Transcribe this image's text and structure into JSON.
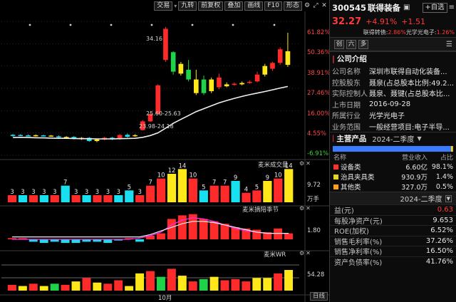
{
  "toolbar": {
    "buttons": [
      "交易",
      "九转",
      "前复权",
      "叠加",
      "画线",
      "F10",
      "形态"
    ],
    "icons": [
      "settings-icon",
      "expand-icon",
      "close-icon"
    ]
  },
  "chart": {
    "price_axis": [
      "61.82%",
      "50.36%",
      "38.91%",
      "27.46%",
      "16.00%",
      "4.55%",
      "-6.91%"
    ],
    "price_annotations": {
      "high": "34.16",
      "mid": "25.60-25.63",
      "low": "23.98-24.18"
    },
    "month_label": "10月",
    "panels": {
      "volume": {
        "title": "麦米成交量",
        "axis": [
          "9.72"
        ],
        "unit": "万手"
      },
      "macd": {
        "title": "麦米摘陪季节",
        "axis": [
          "1.80"
        ]
      },
      "wr": {
        "title": "麦米WR",
        "axis": [
          "54.28"
        ]
      }
    },
    "frequency": "日线"
  },
  "chart_data": {
    "type": "candlestick",
    "title": "",
    "y_axis_percent_ticks": [
      61.82,
      50.36,
      38.91,
      27.46,
      16.0,
      4.55,
      -6.91
    ],
    "labels": {
      "high": "34.16",
      "range_mid": "25.60-25.63",
      "range_low": "23.98-24.18"
    },
    "candles": [
      {
        "o": 3.0,
        "c": 3.6,
        "h": 4.0,
        "l": 2.6,
        "color": "cyan"
      },
      {
        "o": 3.5,
        "c": 3.3,
        "h": 3.9,
        "l": 3.0,
        "color": "cyan"
      },
      {
        "o": 3.3,
        "c": 3.0,
        "h": 3.8,
        "l": 2.8,
        "color": "cyan"
      },
      {
        "o": 3.0,
        "c": 3.4,
        "h": 3.8,
        "l": 2.7,
        "color": "yellow"
      },
      {
        "o": 3.3,
        "c": 3.0,
        "h": 3.6,
        "l": 2.8,
        "color": "cyan"
      },
      {
        "o": 3.0,
        "c": 3.2,
        "h": 3.5,
        "l": 2.6,
        "color": "yellow"
      },
      {
        "o": 2.8,
        "c": 2.3,
        "h": 3.3,
        "l": 2.0,
        "color": "cyan"
      },
      {
        "o": 2.3,
        "c": 2.5,
        "h": 2.9,
        "l": 1.8,
        "color": "yellow"
      },
      {
        "o": 2.5,
        "c": 1.5,
        "h": 2.9,
        "l": 1.2,
        "color": "cyan"
      },
      {
        "o": 1.5,
        "c": 2.0,
        "h": 2.4,
        "l": 1.0,
        "color": "yellow"
      },
      {
        "o": 2.0,
        "c": 0.4,
        "h": 2.4,
        "l": 0.0,
        "color": "cyan"
      },
      {
        "o": 0.4,
        "c": 1.2,
        "h": 1.6,
        "l": -0.2,
        "color": "yellow"
      },
      {
        "o": 1.2,
        "c": 2.1,
        "h": 2.6,
        "l": 0.8,
        "color": "red"
      },
      {
        "o": 2.1,
        "c": 1.4,
        "h": 2.5,
        "l": 0.9,
        "color": "cyan"
      },
      {
        "o": 1.4,
        "c": 3.5,
        "h": 4.1,
        "l": 1.0,
        "color": "red"
      },
      {
        "o": 3.6,
        "c": 2.6,
        "h": 4.3,
        "l": 2.2,
        "color": "cyan"
      },
      {
        "o": 3.0,
        "c": 3.4,
        "h": 3.9,
        "l": 2.6,
        "color": "yellow"
      },
      {
        "o": 6.0,
        "c": 10.5,
        "h": 11.2,
        "l": 5.8,
        "color": "red"
      },
      {
        "o": 10.5,
        "c": 14.3,
        "h": 15.0,
        "l": 10.2,
        "color": "red"
      },
      {
        "o": 14.3,
        "c": 29.0,
        "h": 29.5,
        "l": 14.0,
        "color": "red"
      },
      {
        "o": 42.0,
        "c": 58.0,
        "h": 59.0,
        "l": 41.0,
        "color": "red"
      },
      {
        "o": 46.0,
        "c": 36.0,
        "h": 46.5,
        "l": 34.5,
        "color": "green"
      },
      {
        "o": 35.0,
        "c": 40.0,
        "h": 41.0,
        "l": 34.0,
        "color": "yellow"
      },
      {
        "o": 37.0,
        "c": 32.0,
        "h": 42.0,
        "l": 31.0,
        "color": "green"
      },
      {
        "o": 32.0,
        "c": 25.0,
        "h": 37.0,
        "l": 24.0,
        "color": "yellow"
      },
      {
        "o": 25.0,
        "c": 32.0,
        "h": 34.0,
        "l": 24.0,
        "color": "green"
      },
      {
        "o": 32.0,
        "c": 26.0,
        "h": 33.0,
        "l": 25.0,
        "color": "yellow"
      },
      {
        "o": 28.0,
        "c": 33.0,
        "h": 35.0,
        "l": 27.0,
        "color": "red"
      },
      {
        "o": 28.5,
        "c": 29.5,
        "h": 30.5,
        "l": 28.0,
        "color": "yellow"
      },
      {
        "o": 29.2,
        "c": 29.8,
        "h": 30.5,
        "l": 28.8,
        "color": "red"
      },
      {
        "o": 29.5,
        "c": 30.2,
        "h": 31.0,
        "l": 29.0,
        "color": "yellow"
      },
      {
        "o": 30.2,
        "c": 30.8,
        "h": 31.5,
        "l": 29.8,
        "color": "red"
      },
      {
        "o": 31.0,
        "c": 34.5,
        "h": 36.0,
        "l": 30.5,
        "color": "red"
      },
      {
        "o": 34.5,
        "c": 38.9,
        "h": 40.0,
        "l": 33.5,
        "color": "yellow"
      },
      {
        "o": 37.5,
        "c": 40.5,
        "h": 41.0,
        "l": 36.5,
        "color": "red"
      },
      {
        "o": 40.5,
        "c": 47.5,
        "h": 48.5,
        "l": 39.5,
        "color": "red"
      },
      {
        "o": 39.5,
        "c": 46.5,
        "h": 56.0,
        "l": 38.5,
        "color": "yellow"
      }
    ],
    "ma_line": [
      2.2,
      2.3,
      2.2,
      2.1,
      2.0,
      1.9,
      1.8,
      1.8,
      1.7,
      1.6,
      1.6,
      1.5,
      1.5,
      1.5,
      1.6,
      1.7,
      1.8,
      2.3,
      3.2,
      4.6,
      7.0,
      9.5,
      11.5,
      13.5,
      15.5,
      17.0,
      18.5,
      20.0,
      21.2,
      22.3,
      23.3,
      24.2,
      25.0,
      25.8,
      26.7,
      27.6,
      28.4
    ],
    "volume": {
      "labels": [
        "3",
        "3",
        "3",
        "3",
        "3",
        "7",
        "3",
        "3",
        "3",
        "3",
        "3",
        "5",
        "3",
        "7",
        "10",
        "12",
        "14",
        "10",
        "5",
        "7",
        "7",
        "9",
        "4",
        "5",
        "9",
        "10",
        "14"
      ],
      "values": [
        3,
        3,
        3,
        3,
        3,
        7,
        3,
        3,
        3,
        3,
        3,
        5,
        3,
        7,
        10,
        12,
        14,
        10,
        5,
        7,
        7,
        9,
        4,
        5,
        9,
        10,
        14
      ],
      "colors": [
        "red",
        "cyan",
        "red",
        "cyan",
        "red",
        "cyan",
        "red",
        "cyan",
        "red",
        "red",
        "cyan",
        "cyan",
        "red",
        "red",
        "red",
        "yellow",
        "yellow",
        "red",
        "cyan",
        "red",
        "red",
        "cyan",
        "red",
        "red",
        "yellow",
        "red",
        "yellow"
      ]
    },
    "macd": {
      "values": [
        0.1,
        0.1,
        -0.2,
        -0.3,
        -0.2,
        -0.3,
        -0.3,
        -0.2,
        -0.2,
        -0.3,
        -0.1,
        0.1,
        -0.2,
        0.3,
        0.5,
        1.7,
        2.0,
        2.1,
        1.7,
        1.5,
        1.3,
        1.0,
        0.9,
        0.8,
        0.6,
        0.9,
        0.5
      ],
      "line1": [
        0.0,
        0.0,
        0.0,
        0.0,
        0.0,
        0.0,
        0.0,
        0.0,
        0.0,
        0.0,
        0.0,
        0.0,
        0.1,
        0.3,
        0.6,
        1.2,
        1.6,
        1.8,
        1.7,
        1.5,
        1.2,
        0.9,
        0.7,
        0.6,
        0.5,
        0.5,
        0.5
      ],
      "line2": [
        0.2,
        0.2,
        0.2,
        0.2,
        0.2,
        0.2,
        0.2,
        0.2,
        0.2,
        0.2,
        0.2,
        0.2,
        0.2,
        0.4,
        0.7,
        1.0,
        1.3,
        1.5,
        1.5,
        1.4,
        1.2,
        1.0,
        0.8,
        0.6,
        0.5,
        0.5,
        0.5
      ]
    },
    "wr": {
      "values": [
        0.25,
        0.2,
        0.3,
        0.2,
        0.3,
        0.25,
        0.4,
        0.55,
        0.35,
        0.3,
        0.45,
        0.2,
        0.75,
        0.85,
        0.6,
        0.95,
        0.65,
        0.4,
        0.5,
        0.6,
        0.45,
        0.5,
        0.4,
        0.55,
        0.55,
        0.75,
        0.9
      ],
      "colors": [
        "red",
        "yellow",
        "red",
        "yellow",
        "green",
        "red",
        "yellow",
        "red",
        "yellow",
        "red",
        "red",
        "yellow",
        "yellow",
        "red",
        "green",
        "red",
        "yellow",
        "red",
        "green",
        "yellow",
        "red",
        "red",
        "red",
        "yellow",
        "yellow",
        "red",
        "yellow"
      ]
    }
  },
  "stock": {
    "code": "300545",
    "name": "联得装备",
    "add_button": "+自选",
    "price": "32.27",
    "change_pct": "+4.91%",
    "change": "+1.51",
    "bond_text": "联得转债: ",
    "bond_pct": "2.86%",
    "bond2_text": " 光学光电子: ",
    "bond2_pct": "1.26%"
  },
  "rp_tabs": [
    "创",
    "六",
    "多"
  ],
  "company": {
    "section_title": "公司介绍",
    "rows": [
      {
        "key": "公司名称",
        "val": "深圳市联得自动化装备..."
      },
      {
        "key": "控股股东",
        "val": "聂泉(占总股本比例:49.2..."
      },
      {
        "key": "实际控制人",
        "val": "聂泉、聂键(占总股本比..."
      },
      {
        "key": "上市日期",
        "val": "2016-09-28"
      },
      {
        "key": "所属行业",
        "val": "光学光电子"
      },
      {
        "key": "业务范围",
        "val": "一般经营项目:电子半导..."
      }
    ]
  },
  "products": {
    "title": "主营产品",
    "period": "2024-二季度",
    "headers": [
      "名称",
      "营业收入",
      "占比"
    ],
    "share_colors": [
      "#3a7cff",
      "#e8d41e",
      "#ff9f1a"
    ],
    "share_values": [
      98.1,
      1.4,
      0.5
    ],
    "rows": [
      {
        "name": "设备类",
        "revenue": "6.60亿",
        "share": "98.1%",
        "color": "#ff3030"
      },
      {
        "name": "治具夹具类",
        "revenue": "930.9万",
        "share": "1.4%",
        "color": "#e8d41e"
      },
      {
        "name": "其他类",
        "revenue": "327.0万",
        "share": "0.5%",
        "color": "#ff9f1a"
      }
    ]
  },
  "finance": {
    "period": "2024-二季度",
    "rows": [
      {
        "key": "益(元)",
        "val": "0.63",
        "red": true
      },
      {
        "key": "每股净资产(元)",
        "val": "9.653",
        "red": false
      },
      {
        "key": "ROE(加权)",
        "val": "6.52%",
        "red": false
      },
      {
        "key": "销售毛利率(%)",
        "val": "37.26%",
        "red": false
      },
      {
        "key": "销售净利率(%)",
        "val": "16.50%",
        "red": false
      },
      {
        "key": "资产负债率(%)",
        "val": "41.76%",
        "red": false
      }
    ]
  }
}
